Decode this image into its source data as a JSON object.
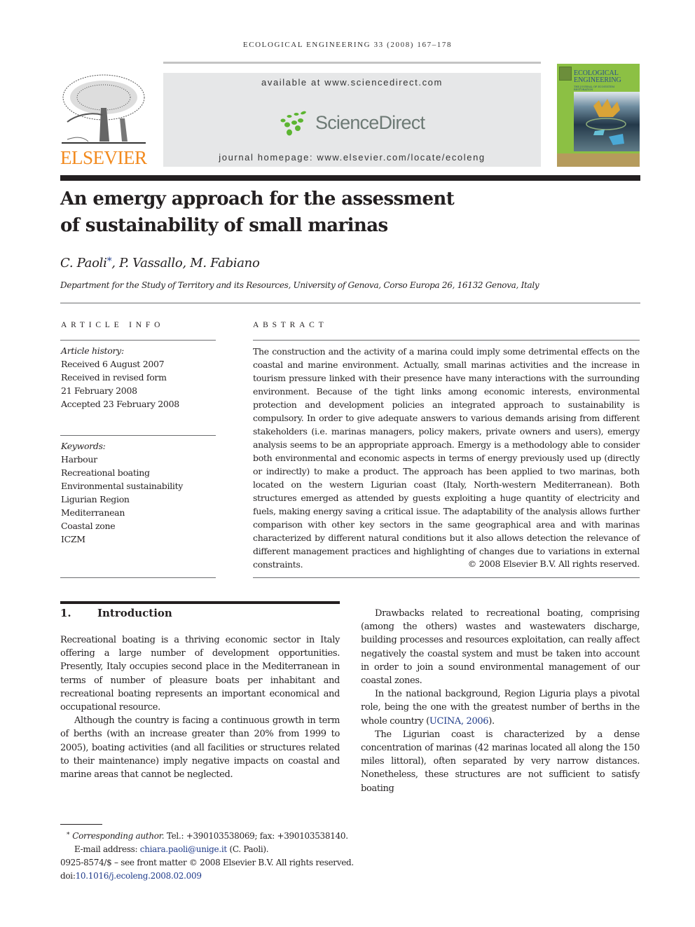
{
  "header": {
    "running_head": "ECOLOGICAL ENGINEERING 33 (2008) 167–178",
    "publisher": "ELSEVIER",
    "available_at": "available at www.sciencedirect.com",
    "sciencedirect_logo": "ScienceDirect",
    "homepage": "journal homepage: www.elsevier.com/locate/ecoleng",
    "cover": {
      "title_line1": "ECOLOGICAL",
      "title_line2": "ENGINEERING",
      "subtitle": "THE JOURNAL OF ECOSYSTEM RESTORATION"
    },
    "colors": {
      "elsevier_orange": "#f28a1e",
      "sciencedirect_green": "#5cb531",
      "link_blue": "#1f3b8a"
    }
  },
  "article": {
    "title_line1": "An emergy approach for the assessment",
    "title_line2": "of sustainability of small marinas",
    "authors": {
      "a1": "C. Paoli",
      "a1_mark": "*",
      "rest": ", P. Vassallo, M. Fabiano"
    },
    "affiliation": "Department for the Study of Territory and its Resources, University of Genova, Corso Europa 26, 16132 Genova, Italy"
  },
  "article_info": {
    "heading": "ARTICLE INFO",
    "history_label": "Article history:",
    "history": [
      "Received 6 August 2007",
      "Received in revised form",
      "21 February 2008",
      "Accepted 23 February 2008"
    ],
    "keywords_label": "Keywords:",
    "keywords": [
      "Harbour",
      "Recreational boating",
      "Environmental sustainability",
      "Ligurian Region",
      "Mediterranean",
      "Coastal zone",
      "ICZM"
    ]
  },
  "abstract": {
    "heading": "ABSTRACT",
    "text": "The construction and the activity of a marina could imply some detrimental effects on the coastal and marine environment. Actually, small marinas activities and the increase in tourism pressure linked with their presence have many interactions with the surrounding environment. Because of the tight links among economic interests, environmental protection and development policies an integrated approach to sustainability is compulsory. In order to give adequate answers to various demands arising from different stakeholders (i.e. marinas managers, policy makers, private owners and users), emergy analysis seems to be an appropriate approach. Emergy is a methodology able to consider both environmental and economic aspects in terms of energy previously used up (directly or indirectly) to make a product. The approach has been applied to two marinas, both located on the western Ligurian coast (Italy, North-western Mediterranean). Both structures emerged as attended by guests exploiting a huge quantity of electricity and fuels, making energy saving a critical issue. The adaptability of the analysis allows further comparison with other key sectors in the same geographical area and with marinas characterized by different natural conditions but it also allows detection the relevance of different management practices and highlighting of changes due to variations in external constraints.",
    "copyright": "© 2008 Elsevier B.V. All rights reserved."
  },
  "section1": {
    "number": "1.",
    "title": "Introduction",
    "left_paragraphs": [
      "Recreational boating is a thriving economic sector in Italy offering a large number of development opportunities. Presently, Italy occupies second place in the Mediterranean in terms of number of pleasure boats per inhabitant and recreational boating represents an important economical and occupational resource.",
      "Although the country is facing a continuous growth in term of berths (with an increase greater than 20% from 1999 to 2005), boating activities (and all facilities or structures related to their maintenance) imply negative impacts on coastal and marine areas that cannot be neglected."
    ],
    "right_paragraphs": {
      "p1": "Drawbacks related to recreational boating, comprising (among the others) wastes and wastewaters discharge, building processes and resources exploitation, can really affect negatively the coastal system and must be taken into account in order to join a sound environmental management of our coastal zones.",
      "p2_before": "In the national background, Region Liguria plays a pivotal role, being the one with the greatest number of berths in the whole country (",
      "p2_link": "UCINA, 2006",
      "p2_after": ").",
      "p3": "The Ligurian coast is characterized by a dense concentration of marinas (42 marinas located all along the 150 miles littoral), often separated by very narrow distances. Nonetheless, these structures are not sufficient to satisfy boating"
    }
  },
  "footnotes": {
    "star": "*",
    "corr_label": "Corresponding author.",
    "corr_contact": " Tel.: +390103538069; fax: +390103538140.",
    "email_label": "E-mail address: ",
    "email": "chiara.paoli@unige.it",
    "email_after": " (C. Paoli).",
    "issn_line": "0925-8574/$ – see front matter © 2008 Elsevier B.V. All rights reserved.",
    "doi_label": "doi:",
    "doi": "10.1016/j.ecoleng.2008.02.009"
  }
}
